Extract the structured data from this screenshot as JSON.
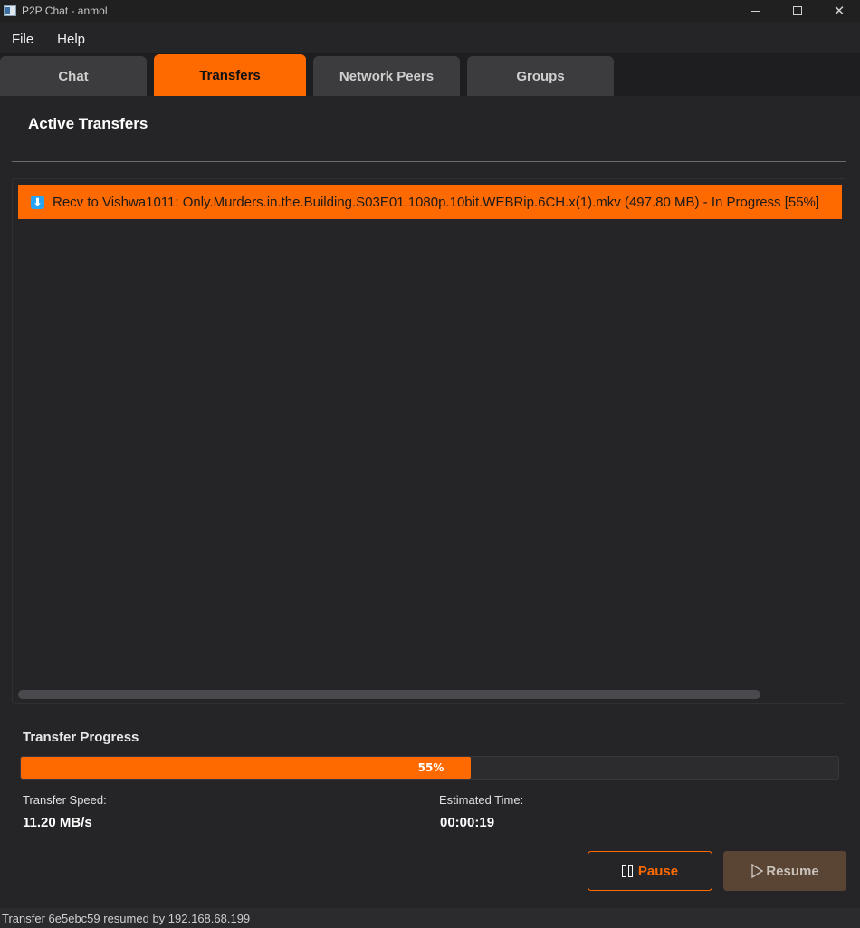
{
  "window": {
    "title": "P2P Chat - anmol",
    "icon": "app-window-icon",
    "controls": [
      "minimize-icon",
      "maximize-icon",
      "close-icon"
    ]
  },
  "menu": {
    "items": [
      {
        "label": "File"
      },
      {
        "label": "Help"
      }
    ]
  },
  "tabs": [
    {
      "label": "Chat",
      "active": false
    },
    {
      "label": "Transfers",
      "active": true
    },
    {
      "label": "Network Peers",
      "active": false
    },
    {
      "label": "Groups",
      "active": false
    }
  ],
  "main": {
    "section_title": "Active Transfers",
    "transfers": [
      {
        "icon": "download-arrow-icon",
        "text": "Recv to Vishwa1011: Only.Murders.in.the.Building.S03E01.1080p.10bit.WEBRip.6CH.x(1).mkv (497.80 MB) - In Progress [55%]",
        "selected": true
      }
    ]
  },
  "progress": {
    "title": "Transfer Progress",
    "percent": 55,
    "label": "55%",
    "speed_label": "Transfer Speed:",
    "speed_value": "11.20 MB/s",
    "eta_label": "Estimated Time:",
    "eta_value": "00:00:19"
  },
  "actions": {
    "pause_label": "Pause",
    "resume_label": "Resume"
  },
  "status": {
    "text": "Transfer 6e5ebc59 resumed by 192.168.68.199"
  },
  "colors": {
    "accent": "#ff6a00",
    "background": "#252528",
    "tab_inactive": "#3c3c3f",
    "info_icon": "#29a3f3"
  }
}
